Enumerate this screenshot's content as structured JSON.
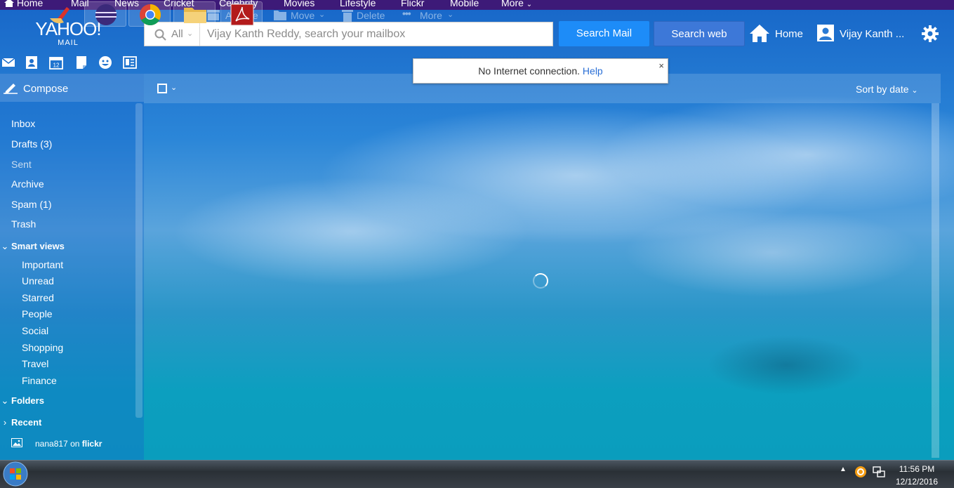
{
  "top_nav": {
    "items": [
      "Home",
      "Mail",
      "News",
      "Cricket",
      "Celebrity",
      "Movies",
      "Lifestyle",
      "Flickr",
      "Mobile",
      "More"
    ]
  },
  "logo": {
    "main": "YAHOO!",
    "sub": "MAIL"
  },
  "search": {
    "scope": "All",
    "placeholder": "Vijay Kanth Reddy, search your mailbox",
    "search_mail_label": "Search Mail",
    "search_web_label": "Search web"
  },
  "header": {
    "home_label": "Home",
    "user_label": "Vijay Kanth ..."
  },
  "app_icons": [
    "mail-icon",
    "contacts-icon",
    "calendar-icon",
    "notepad-icon",
    "messenger-icon",
    "newsfeed-icon"
  ],
  "calendar_day": "12",
  "toast": {
    "message": "No Internet connection.",
    "help_label": "Help",
    "close_label": "×"
  },
  "sidebar": {
    "compose_label": "Compose",
    "folders": [
      {
        "label": "Inbox"
      },
      {
        "label": "Drafts (3)"
      },
      {
        "label": "Sent"
      },
      {
        "label": "Archive"
      },
      {
        "label": "Spam (1)"
      },
      {
        "label": "Trash"
      }
    ],
    "smart_views_label": "Smart views",
    "smart_views": [
      "Important",
      "Unread",
      "Starred",
      "People",
      "Social",
      "Shopping",
      "Travel",
      "Finance"
    ],
    "folders_label": "Folders",
    "recent_label": "Recent",
    "flickr_user": "nana817",
    "flickr_on": "on",
    "flickr_brand": "flickr"
  },
  "toolbar": {
    "archive_label": "Archive",
    "move_label": "Move",
    "delete_label": "Delete",
    "more_label": "More",
    "sort_label": "Sort by date"
  },
  "taskbar": {
    "apps": [
      "start-button",
      "ccleaner-icon",
      "eclipse-icon",
      "chrome-icon",
      "file-explorer-icon",
      "acrobat-reader-icon"
    ],
    "time": "11:56 PM",
    "date": "12/12/2016"
  },
  "colors": {
    "top_nav_bg": "#3d1a78",
    "search_mail_bg": "#1d8cf8",
    "search_web_bg": "#3d78d8",
    "help_link": "#2a6fd6"
  }
}
